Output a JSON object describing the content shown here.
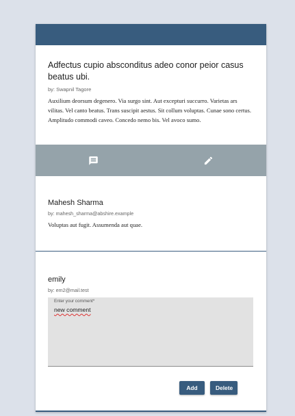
{
  "colors": {
    "primary": "#385c7e",
    "action_bar": "#95a3aa",
    "background": "#dce1ea"
  },
  "post": {
    "title": "Adfectus cupio absconditus adeo conor peior casus beatus ubi.",
    "byline": "by: Swapnil Tagore",
    "body": "Auxilium deorsum degenero. Via surgo sint. Aut excepturi succurro. Varietas ars vilitas. Vel canto beatus. Trans suscipit aestus. Sit collum voluptas. Cunae sono certus. Amplitudo commodi caveo. Concedo nemo bis. Vel avoco sumo."
  },
  "actions": {
    "comment_icon": "comment-icon",
    "edit_icon": "edit-pencil-icon"
  },
  "comments": [
    {
      "name": "Mahesh Sharma",
      "byline": "by: mahesh_sharma@abshire.example",
      "text": "Voluptas aut fugit. Assumenda aut quae."
    }
  ],
  "editing": {
    "name": "emily",
    "byline": "by: em2@mail.test",
    "field_label": "Enter your comment*",
    "value": "new comment",
    "add_label": "Add",
    "delete_label": "Delete"
  }
}
